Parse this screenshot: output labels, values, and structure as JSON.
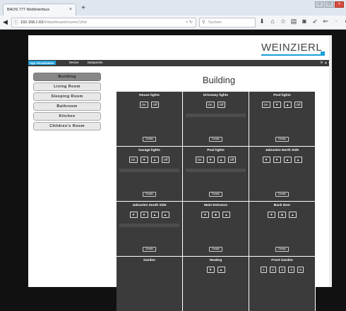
{
  "browser": {
    "tab_title": "BAOS 777 WebInterface",
    "tab_close": "×",
    "new_tab": "+",
    "url_host": "192.168.1.63",
    "url_path": "/#/dashboard/rooms/1/list",
    "search_placeholder": "Suchen",
    "window_buttons": [
      "‒",
      "□",
      "×"
    ]
  },
  "app": {
    "logo": "WEINZIERL",
    "nav": [
      {
        "label": "App Visualization",
        "active": true
      },
      {
        "label": "Device",
        "active": false
      },
      {
        "label": "Datapoints",
        "active": false
      }
    ],
    "nav_icons": "⚙ ▲ ▪"
  },
  "sidebar": {
    "items": [
      {
        "label": "Building",
        "active": true
      },
      {
        "label": "Living Room",
        "active": false
      },
      {
        "label": "Sleeping Room",
        "active": false
      },
      {
        "label": "Bathroom",
        "active": false
      },
      {
        "label": "Kitchen",
        "active": false
      },
      {
        "label": "Children's Room",
        "active": false
      }
    ]
  },
  "page_title": "Building",
  "details_label": "Details",
  "cards": [
    {
      "title": "House lights",
      "buttons": [
        "On",
        "Off"
      ],
      "slider": false,
      "details": true
    },
    {
      "title": "Driveway lights",
      "buttons": [
        "On",
        "Off"
      ],
      "slider": true,
      "details": true
    },
    {
      "title": "Pool lights",
      "buttons": [
        "On",
        "▼",
        "▲",
        "Off"
      ],
      "slider": false,
      "details": true
    },
    {
      "title": "Garage lights",
      "buttons": [
        "On",
        "▼",
        "▲",
        "Off"
      ],
      "slider": true,
      "details": true
    },
    {
      "title": "Pool lights",
      "buttons": [
        "On",
        "▼",
        "▲",
        "Off"
      ],
      "slider": true,
      "details": true
    },
    {
      "title": "Jalousies North Side",
      "buttons": [
        "▼",
        "▼",
        "▲",
        "▲"
      ],
      "slider": false,
      "details": true
    },
    {
      "title": "Jalousies South Side",
      "buttons": [
        "▼",
        "▼",
        "▲",
        "▲"
      ],
      "slider": true,
      "details": true
    },
    {
      "title": "Main Entrance",
      "buttons": [
        "▼",
        "■",
        "▲"
      ],
      "slider": false,
      "details": true
    },
    {
      "title": "Back door",
      "buttons": [
        "▼",
        "■",
        "▲"
      ],
      "slider": false,
      "details": true
    },
    {
      "title": "Garden",
      "buttons": [],
      "slider": false,
      "details": false
    },
    {
      "title": "Heating",
      "buttons": [
        "▼",
        "▲"
      ],
      "slider": false,
      "details": false
    },
    {
      "title": "Front Garden",
      "buttons": [
        "1",
        "2",
        "3",
        "4",
        "5"
      ],
      "slider": false,
      "details": false
    }
  ]
}
